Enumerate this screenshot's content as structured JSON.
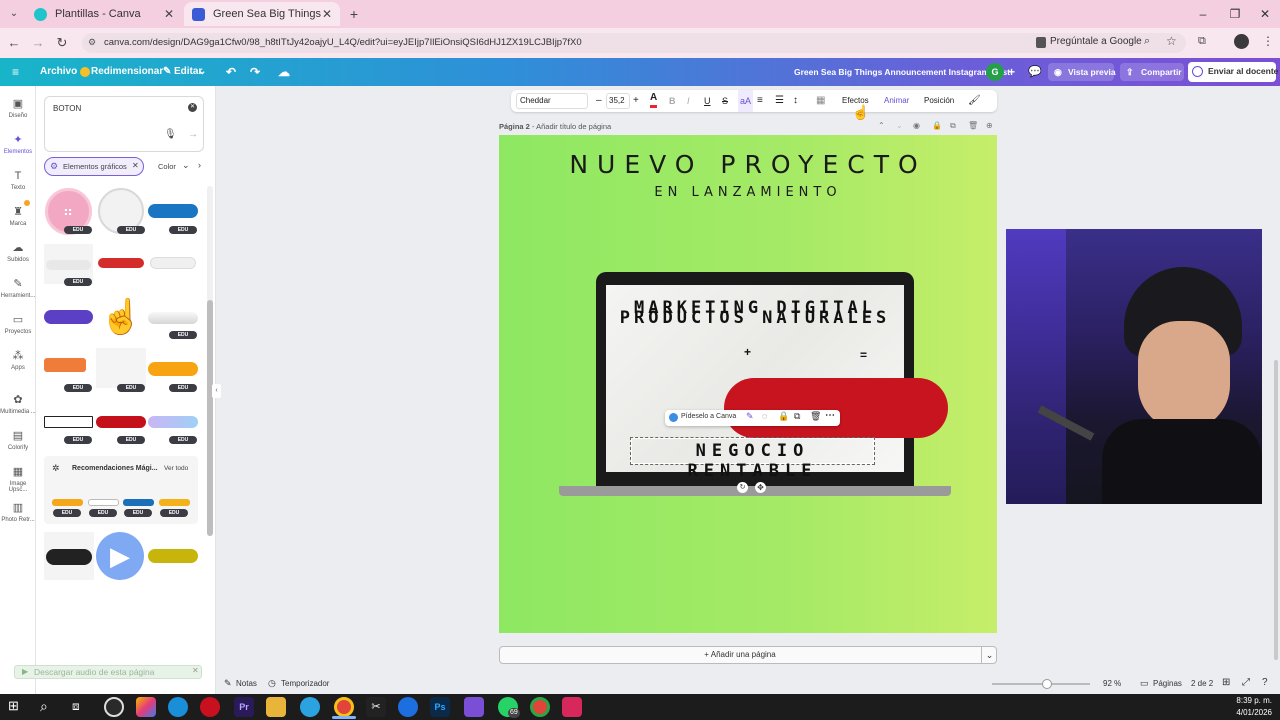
{
  "browser": {
    "tabs": [
      {
        "title": "Plantillas - Canva",
        "active": false
      },
      {
        "title": "Green Sea Big Things Announc",
        "active": true
      }
    ],
    "url": "canva.com/design/DAG9ga1Cfw0/98_h8tITtJy42oajyU_L4Q/edit?ui=eyJEIjp7IlEiOnsiQSI6dHJ1ZX19LCJBIjp7fX0",
    "ask_google": "Pregúntale a Google"
  },
  "header": {
    "archivo": "Archivo",
    "redimensionar": "Redimensionar",
    "editar": "Editar",
    "design_title": "Green Sea Big Things Announcement Instagram Post",
    "avatar_letter": "G",
    "vista_previa": "Vista previa",
    "compartir": "Compartir",
    "enviar": "Enviar al docente"
  },
  "rail": [
    {
      "label": "Diseño",
      "icon": "layout-icon"
    },
    {
      "label": "Elementos",
      "icon": "shapes-icon"
    },
    {
      "label": "Texto",
      "icon": "text-icon"
    },
    {
      "label": "Marca",
      "icon": "brand-icon"
    },
    {
      "label": "Subidos",
      "icon": "cloud-upload-icon"
    },
    {
      "label": "Herramient...",
      "icon": "pen-icon"
    },
    {
      "label": "Proyectos",
      "icon": "folder-icon"
    },
    {
      "label": "Apps",
      "icon": "apps-icon"
    },
    {
      "label": "Multimedia ...",
      "icon": "media-icon"
    },
    {
      "label": "Colorify",
      "icon": "colorify-icon"
    },
    {
      "label": "Image Upsc...",
      "icon": "upscale-icon"
    },
    {
      "label": "Photo Retr...",
      "icon": "photo-icon"
    }
  ],
  "panel": {
    "search_value": "BOTON",
    "filter_chip": "Elementos gráficos",
    "color_filter": "Color",
    "edu_badge": "EDU",
    "recommendations": "Recomendaciones Mági...",
    "ver_todo": "Ver todo",
    "audio_notice": "Descargar audio de esta página"
  },
  "toolbar": {
    "font": "Cheddar",
    "font_size": "35,2",
    "efectos": "Efectos",
    "animar": "Animar",
    "posicion": "Posición"
  },
  "page": {
    "label": "Página 2",
    "add_title": "Añadir título de página",
    "title": "NUEVO PROYECTO",
    "subtitle": "EN LANZAMIENTO",
    "screen_line1": "MARKETING DIGITAL",
    "screen_line2": "PRODUCTOS NATURALES",
    "screen_line3": "NEGOCIO RENTABLE",
    "float_menu": "Pídeselo a Canva",
    "add_page": "+ Añadir una página"
  },
  "bottom": {
    "notas": "Notas",
    "temporizador": "Temporizador",
    "zoom": "92 %",
    "paginas": "Páginas",
    "page_count": "2 de 2"
  },
  "taskbar": {
    "time": "8:39 p. m.",
    "date": "4/01/2026",
    "whatsapp_badge": "69"
  },
  "colors": {
    "canva_gradient_start": "#18b5c9",
    "canva_gradient_end": "#7b4fd6",
    "page_green": "#9be864",
    "red_button": "#c8141e"
  }
}
